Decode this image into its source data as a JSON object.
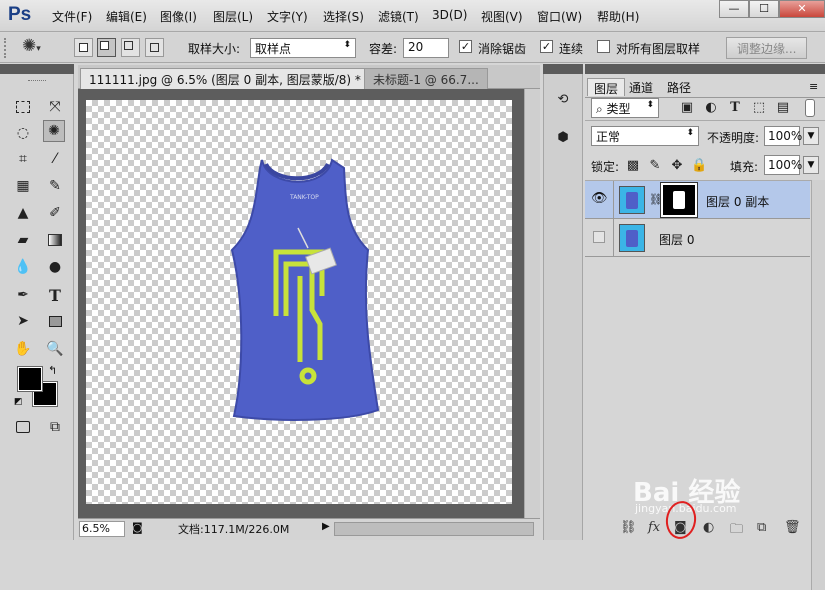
{
  "app": {
    "logo": "Ps"
  },
  "menu": [
    "文件(F)",
    "编辑(E)",
    "图像(I)",
    "图层(L)",
    "文字(Y)",
    "选择(S)",
    "滤镜(T)",
    "3D(D)",
    "视图(V)",
    "窗口(W)",
    "帮助(H)"
  ],
  "window_buttons": [
    "—",
    "☐",
    "✕"
  ],
  "options": {
    "sample_size_label": "取样大小:",
    "sample_size_value": "取样点",
    "tolerance_label": "容差:",
    "tolerance_value": "20",
    "antialias_label": "消除锯齿",
    "antialias_checked": true,
    "contiguous_label": "连续",
    "contiguous_checked": true,
    "all_layers_label": "对所有图层取样",
    "all_layers_checked": false,
    "refine_edge_label": "调整边缘..."
  },
  "document": {
    "tabs": [
      "111111.jpg @ 6.5% (图层 0 副本, 图层蒙版/8) *  ✕",
      "未标题-1 @ 66.7..."
    ],
    "zoom": "6.5%",
    "doc_info": "文档:117.1M/226.0M",
    "shirt_tag_text": "TANK-TOP"
  },
  "layers_panel": {
    "tabs": [
      "图层",
      "通道",
      "路径"
    ],
    "filter_kind": "类型",
    "blend_mode": "正常",
    "opacity_label": "不透明度:",
    "opacity_value": "100%",
    "lock_label": "锁定:",
    "fill_label": "填充:",
    "fill_value": "100%",
    "layers": [
      {
        "name": "图层 0 副本",
        "visible": true,
        "selected": true,
        "has_mask": true
      },
      {
        "name": "图层 0",
        "visible": false,
        "selected": false,
        "has_mask": false
      }
    ]
  },
  "watermark": {
    "text": "Bai 经验",
    "url": "jingyan.baidu.com"
  },
  "colors": {
    "accent_selected": "#b4c8ea",
    "shirt": "#4f5fc8",
    "print": "#c8e23a",
    "annotation": "#e02020"
  }
}
